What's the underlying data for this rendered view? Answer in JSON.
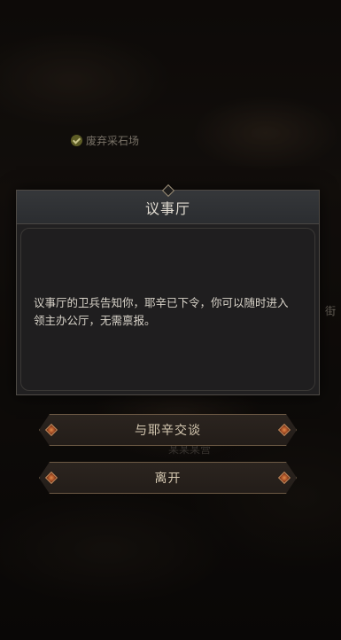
{
  "map": {
    "marker_label": "废弃采石场",
    "fragment_right": "街",
    "fragment_bottom": "某某某营"
  },
  "dialog": {
    "title": "议事厅",
    "text": "议事厅的卫兵告知你，耶辛已下令，你可以随时进入领主办公厅，无需禀报。"
  },
  "options": [
    {
      "label": "与耶辛交谈"
    },
    {
      "label": "离开"
    }
  ],
  "colors": {
    "panel_bg": "#212021",
    "header_bg": "#2f3134",
    "button_border": "#6d5a45",
    "gem": "#e08a4a",
    "text_light": "#d9d4ca"
  }
}
